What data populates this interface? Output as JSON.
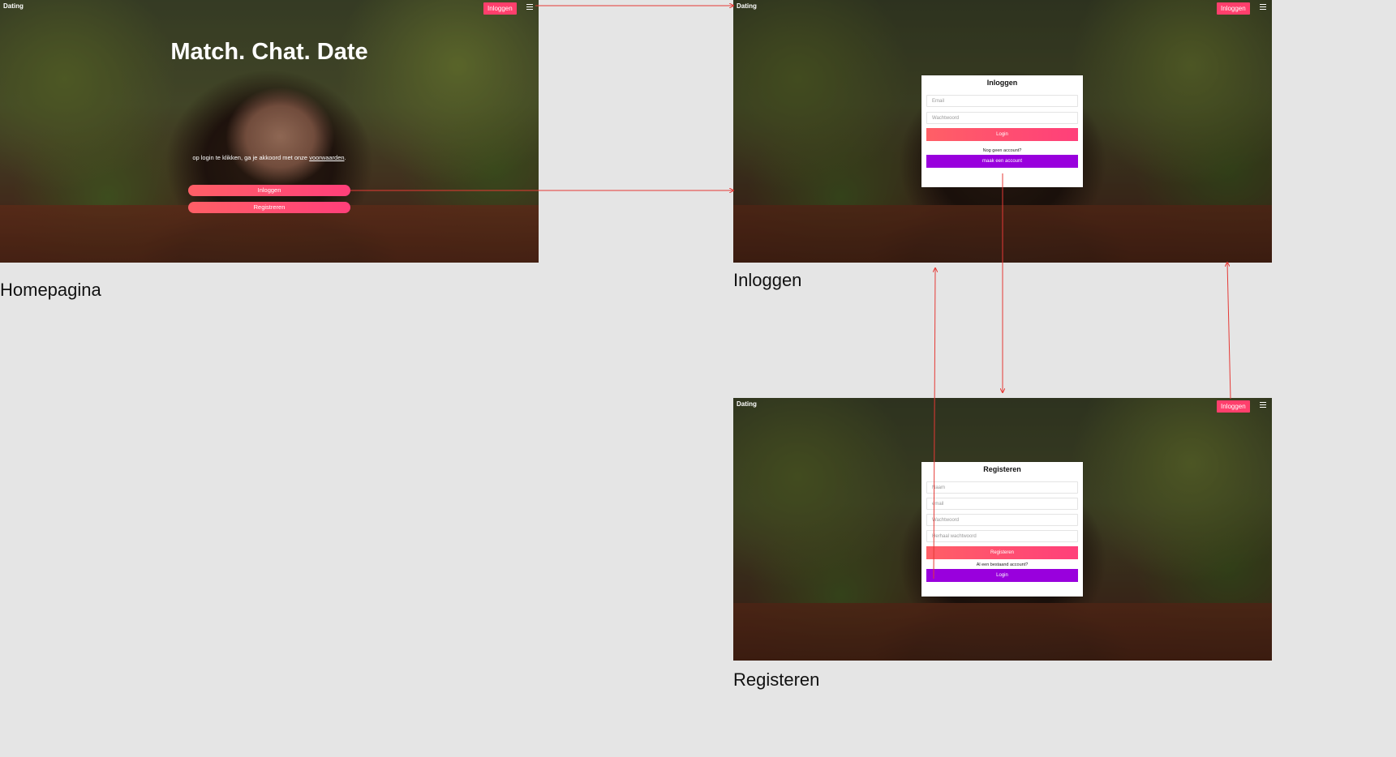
{
  "brand": "Dating",
  "nav_login": "Inloggen",
  "home": {
    "title": "Match. Chat. Date",
    "terms_prefix": "op login te klikken, ga je akkoord met onze ",
    "terms_link": "voorwaarden",
    "terms_suffix": ".",
    "login_button": "Inloggen",
    "register_button": "Registreren",
    "caption": "Homepagina"
  },
  "login": {
    "title": "Inloggen",
    "email_placeholder": "Email",
    "password_placeholder": "Wachtwoord",
    "submit": "Login",
    "no_account": "Nog geen account?",
    "create_account": "maak een account",
    "caption": "Inloggen"
  },
  "register": {
    "title": "Registeren",
    "name_placeholder": "Naam",
    "email_placeholder": "email",
    "password_placeholder": "Wachtwoord",
    "repeat_password_placeholder": "Herhaal wachtwoord",
    "submit": "Registeren",
    "have_account": "Al een bestaand account?",
    "login": "Login",
    "caption": "Registeren"
  },
  "colors": {
    "accent": "#ff3f6c",
    "secondary": "#9900dd",
    "arrow": "#e53935",
    "background": "#e5e5e5"
  },
  "icons": [
    "menu-icon"
  ]
}
